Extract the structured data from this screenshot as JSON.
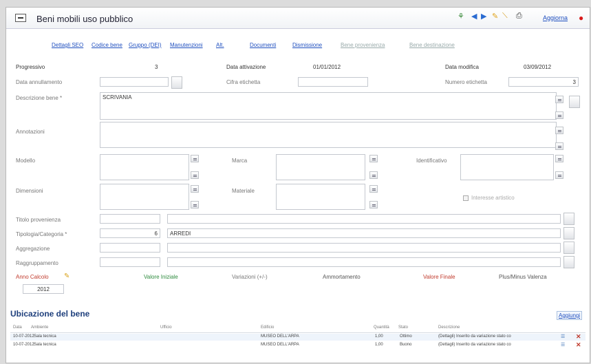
{
  "window": {
    "title": "Beni mobili uso pubblico",
    "toolbar": {
      "icons": [
        "tree-icon",
        "prev-icon",
        "next-icon",
        "edit-icon",
        "cancel-icon",
        "print-icon",
        "close-icon"
      ],
      "save_label": "Aggiorna"
    }
  },
  "tabs": [
    {
      "label": "Dettagli SEO",
      "enabled": true
    },
    {
      "label": "Codice bene",
      "enabled": true
    },
    {
      "label": "Gruppo (DEI)",
      "enabled": true
    },
    {
      "label": "Manutenzioni",
      "enabled": true
    },
    {
      "label": "Alt.",
      "enabled": true
    },
    {
      "label": "Documenti",
      "enabled": true
    },
    {
      "label": "Dismissione",
      "enabled": true
    },
    {
      "label": "Bene provenienza",
      "enabled": false
    },
    {
      "label": "Bene destinazione",
      "enabled": false
    }
  ],
  "form": {
    "progressivo_label": "Progressivo",
    "progressivo_value": "3",
    "data_attivazione_label": "Data attivazione",
    "data_attivazione_value": "01/01/2012",
    "data_modifica_label": "Data modifica",
    "data_modifica_value": "03/09/2012",
    "data_annullamento_label": "Data annullamento",
    "data_annullamento_value": "",
    "cifra_etichetta_label": "Cifra etichetta",
    "cifra_etichetta_value": "",
    "numero_etichetta_label": "Numero etichetta",
    "numero_etichetta_value": "3",
    "descrizione_label": "Descrizione bene *",
    "descrizione_value": "SCRIVANIA",
    "annotazioni_label": "Annotazioni",
    "modello_label": "Modello",
    "marca_label": "Marca",
    "identificativo_label": "Identificativo",
    "dimensioni_label": "Dimensioni",
    "materiale_label": "Materiale",
    "interesse_artistico_label": "Interesse artistico",
    "titolo_provenienza_label": "Titolo provenienza",
    "tipologia_label": "Tipologia/Categoria *",
    "tipologia_code": "6",
    "tipologia_value": "ARREDI",
    "aggregazione_label": "Aggregazione",
    "raggruppamento_label": "Raggruppamento",
    "anno_calcolo_label": "Anno Calcolo",
    "anno_calcolo_value": "2012",
    "valore_iniziale_label": "Valore Iniziale",
    "variazioni_label": "Variazioni (+/-)",
    "ammortamento_label": "Ammortamento",
    "valore_finale_label": "Valore Finale",
    "plusminus_label": "Plus/Minus Valenza"
  },
  "ubicazione": {
    "title": "Ubicazione del bene",
    "add_label": "Aggiungi",
    "columns": [
      "Data",
      "Ambiente",
      "Ufficio",
      "Edificio",
      "Quantità",
      "Stato",
      "Descrizione"
    ],
    "rows": [
      {
        "data": "10-07-2012",
        "ambiente": "Sala tecnica",
        "ufficio": "",
        "edificio": "MUSEO DELL'ARPA",
        "quantita": "1,00",
        "stato": "Ottimo",
        "descrizione": "(Dettagli) Inserito da variazione stato co"
      },
      {
        "data": "10-07-2012",
        "ambiente": "Sala tecnica",
        "ufficio": "",
        "edificio": "MUSEO DELL'ARPA",
        "quantita": "1,00",
        "stato": "Buono",
        "descrizione": "(Dettagli) Inserito da variazione stato co"
      }
    ]
  }
}
